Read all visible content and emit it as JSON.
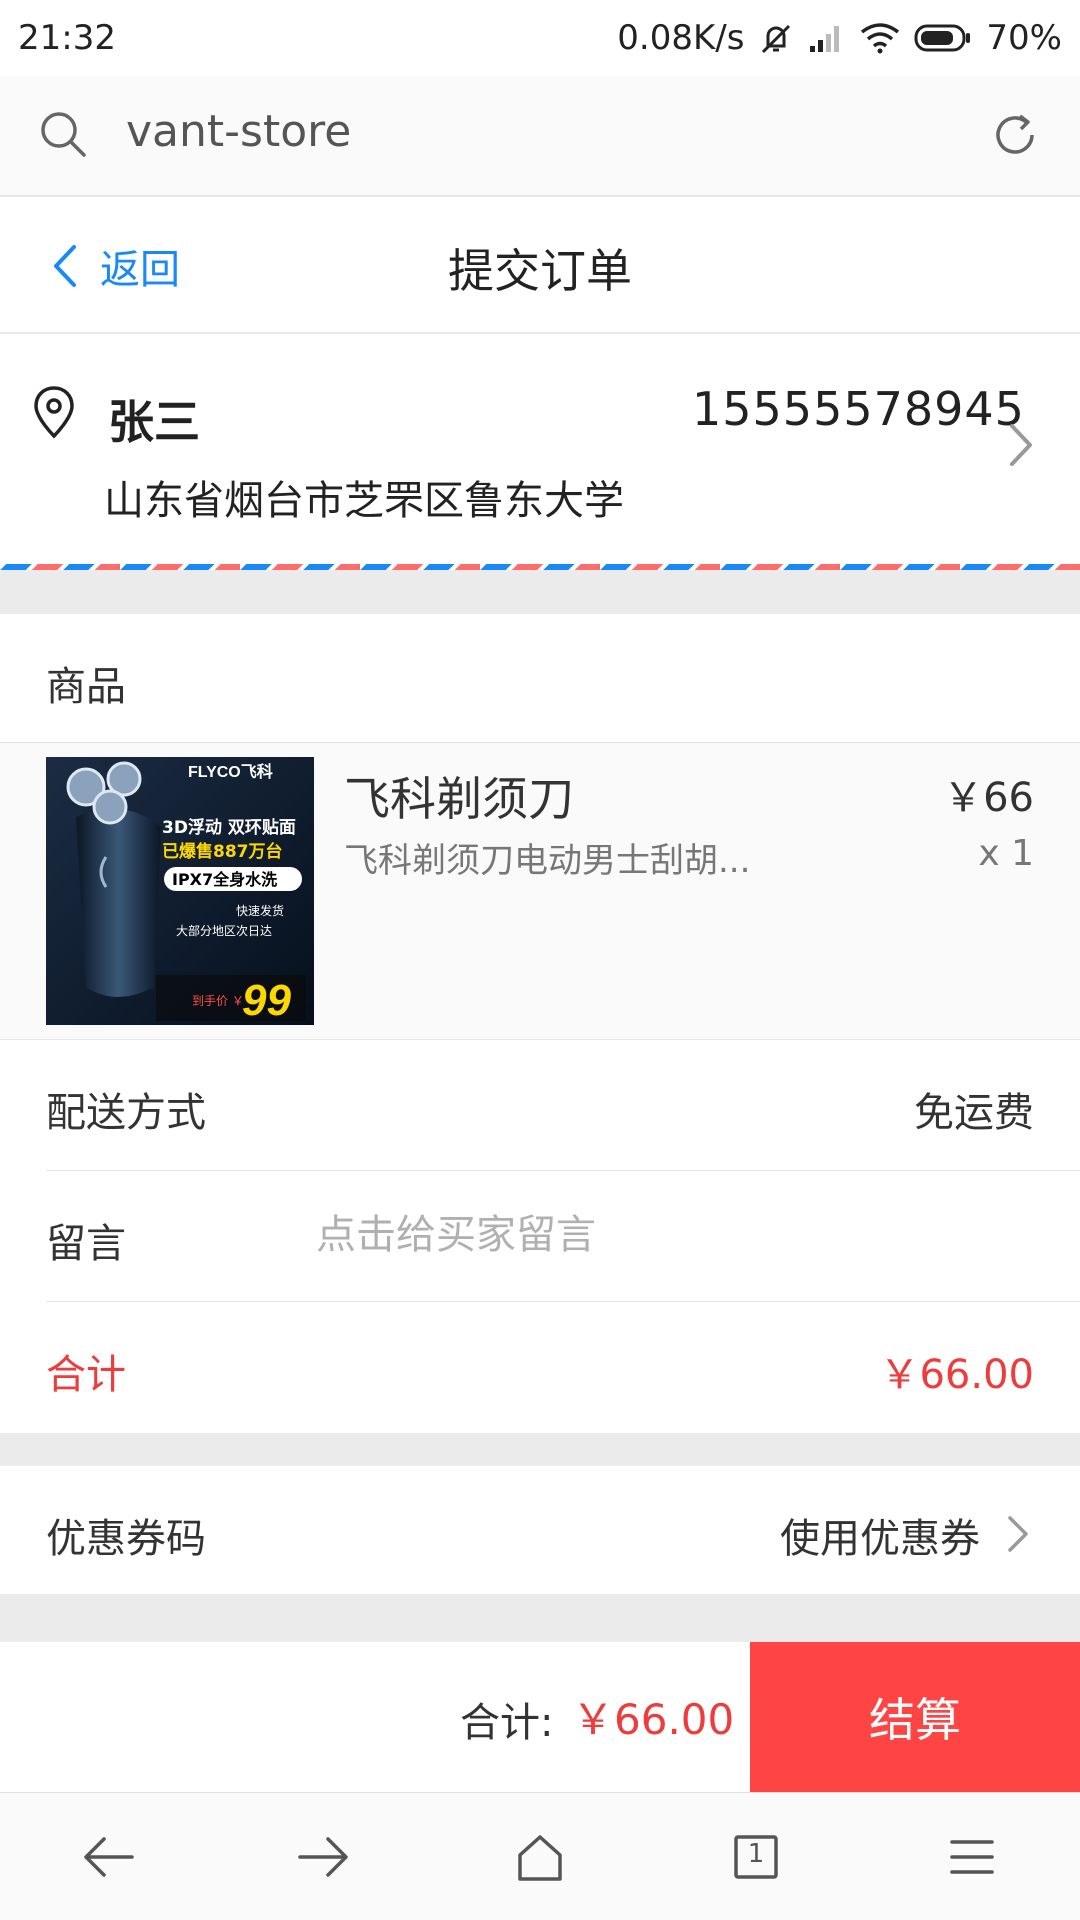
{
  "status_bar": {
    "time": "21:32",
    "net_speed": "0.08K/s",
    "battery": "70%"
  },
  "browser": {
    "url": "vant-store",
    "icons": [
      "search-icon",
      "refresh-icon"
    ]
  },
  "nav": {
    "back_label": "返回",
    "title": "提交订单"
  },
  "address": {
    "name": "张三",
    "phone": "15555578945",
    "detail": "山东省烟台市芝罘区鲁东大学"
  },
  "goods": {
    "header": "商品",
    "items": [
      {
        "title": "飞科剃须刀",
        "desc": "飞科剃须刀电动男士刮胡...",
        "price": "￥66",
        "qty": "x 1",
        "thumb": {
          "brand": "FLYCO飞科",
          "line1": "3D浮动 双环贴面",
          "line2": "已爆售887万台",
          "line3": "IPX7全身水洗",
          "line4": "快速发货",
          "line5": "大部分地区次日达",
          "price_label": "到手价 ￥",
          "price": "99"
        }
      }
    ]
  },
  "cells": {
    "delivery_label": "配送方式",
    "delivery_value": "免运费",
    "message_label": "留言",
    "message_placeholder": "点击给买家留言",
    "total_label": "合计",
    "total_value": "￥66.00"
  },
  "coupon": {
    "label": "优惠券码",
    "value": "使用优惠券"
  },
  "submit_bar": {
    "total_label": "合计:",
    "total_price": "￥66.00",
    "button_label": "结算",
    "accent": "#ff4444"
  },
  "bottom_nav": {
    "tab_count": "1",
    "icons": [
      "back-arrow-icon",
      "forward-arrow-icon",
      "home-icon",
      "tabs-icon",
      "menu-icon"
    ]
  },
  "colors": {
    "primary_blue": "#1989fa",
    "red": "#ee3b3b"
  }
}
